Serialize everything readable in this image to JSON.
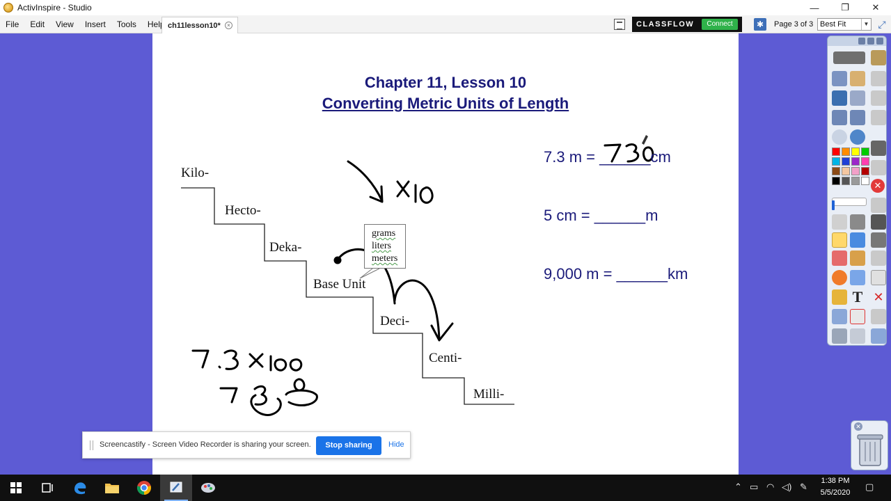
{
  "window": {
    "title": "ActivInspire - Studio",
    "minimize": "—",
    "restore": "❐",
    "close": "✕"
  },
  "menu": {
    "items": [
      "File",
      "Edit",
      "View",
      "Insert",
      "Tools",
      "Help"
    ],
    "document_tab": "ch11lesson10*",
    "tab_close": "×"
  },
  "toolbar": {
    "classflow_label": "CLASSFLOW",
    "classflow_connect": "Connect",
    "page_indicator": "Page 3 of 3",
    "zoom_value": "Best Fit",
    "zoom_arrow": "▼"
  },
  "lesson": {
    "title": "Chapter 11, Lesson 10",
    "subtitle": "Converting Metric Units of Length",
    "steps": [
      "Kilo-",
      "Hecto-",
      "Deka-",
      "Base Unit",
      "Deci-",
      "Centi-",
      "Milli-"
    ],
    "base_units": [
      "grams",
      "liters",
      "meters"
    ],
    "problems": [
      "7.3 m = ______cm",
      "5 cm = ______m",
      "9,000 m = ______km"
    ]
  },
  "share_bar": {
    "message": "Screencastify - Screen Video Recorder is sharing your screen.",
    "stop_label": "Stop sharing",
    "hide_label": "Hide"
  },
  "taskbar": {
    "time": "1:38 PM",
    "date": "5/5/2020"
  },
  "palette": [
    "#ff0000",
    "#ff8c00",
    "#ffff00",
    "#00cc00",
    "#00b4e6",
    "#1f3fd6",
    "#9b27c9",
    "#ff3fb0",
    "#8b4a16",
    "#f4c7a1",
    "#f2a0c8",
    "#b40000",
    "#000000",
    "#555555",
    "#9a9a9a",
    "#ffffff"
  ]
}
